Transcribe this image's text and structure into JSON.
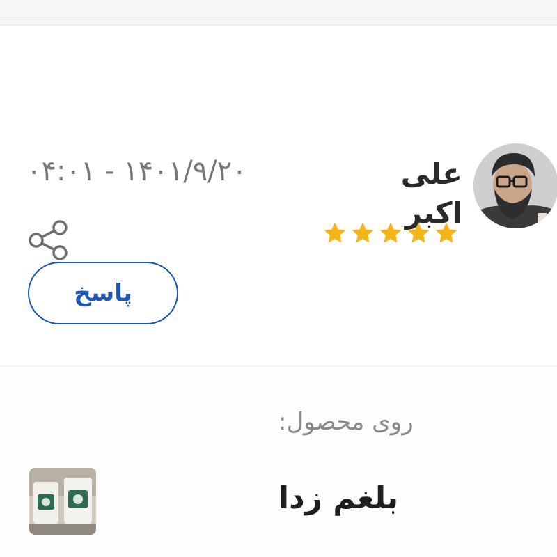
{
  "comment": {
    "author_name": "علی اکبر",
    "datetime": "۰۴:۰۱ - ۱۴۰۱/۹/۲۰",
    "rating": 5,
    "rating_max": 5,
    "reply_label": "پاسخ"
  },
  "product_section": {
    "label": "روی محصول:",
    "product_name": "بلغم زدا"
  },
  "colors": {
    "star": "#f4b41a",
    "reply_border": "#1b57b3",
    "share_icon": "#6f6f6f"
  },
  "icons": {
    "share": "share-icon",
    "star": "star-icon",
    "avatar": "avatar",
    "product": "product-thumbnail"
  }
}
